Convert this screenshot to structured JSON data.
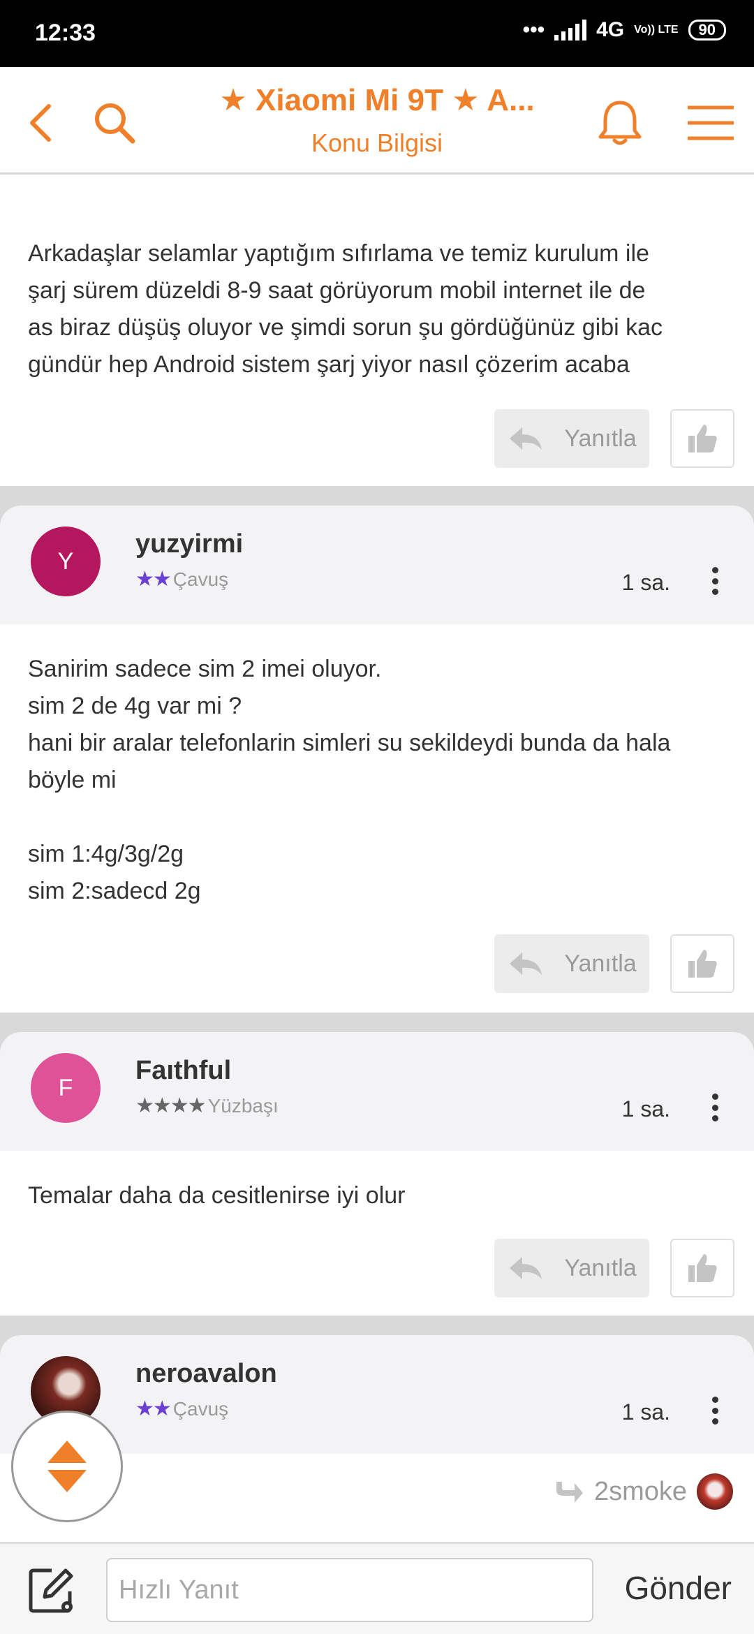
{
  "status_bar": {
    "time": "12:33",
    "network": "4G",
    "volte": "Vo)) LTE",
    "battery": "90"
  },
  "header": {
    "title": "★ Xiaomi Mi 9T ★ A...",
    "subtitle": "Konu Bilgisi",
    "accent_color": "#f07f2a",
    "icons": [
      "back-arrow-icon",
      "search-icon",
      "bell-icon",
      "menu-icon"
    ]
  },
  "first_post": {
    "text": "Arkadaşlar selamlar yaptığım sıfırlama ve temiz kurulum ile\nşarj sürem düzeldi 8-9 saat görüyorum mobil internet ile de\nas biraz düşüş oluyor ve şimdi sorun şu gördüğünüz gibi kac\ngündür hep Android sistem şarj yiyor nasıl çözerim acaba",
    "reply_label": "Yanıtla"
  },
  "posts": [
    {
      "username": "yuzyirmi",
      "avatar_letter": "Y",
      "avatar_color": "#b5175e",
      "stars": "★★",
      "star_color": "#6a3fd1",
      "rank": "Çavuş",
      "time": "1 sa.",
      "text": "Sanirim sadece sim 2 imei oluyor.\nsim 2 de 4g var mi ?\nhani bir aralar telefonlarin simleri su sekildeydi bunda da hala\nböyle mi\n\nsim 1:4g/3g/2g\nsim 2:sadecd 2g",
      "reply_label": "Yanıtla"
    },
    {
      "username": "Faıthful",
      "avatar_letter": "F",
      "avatar_color": "#e05297",
      "stars": "★★★★",
      "star_color": "#666666",
      "rank": "Yüzbaşı",
      "time": "1 sa.",
      "text": "Temalar daha da cesitlenirse iyi olur",
      "reply_label": "Yanıtla"
    },
    {
      "username": "neroavalon",
      "stars": "★★",
      "star_color": "#6a3fd1",
      "rank": "Çavuş",
      "time": "1 sa.",
      "quoted_user": "2smoke"
    }
  ],
  "bottom_bar": {
    "placeholder": "Hızlı Yanıt",
    "send_label": "Gönder"
  }
}
